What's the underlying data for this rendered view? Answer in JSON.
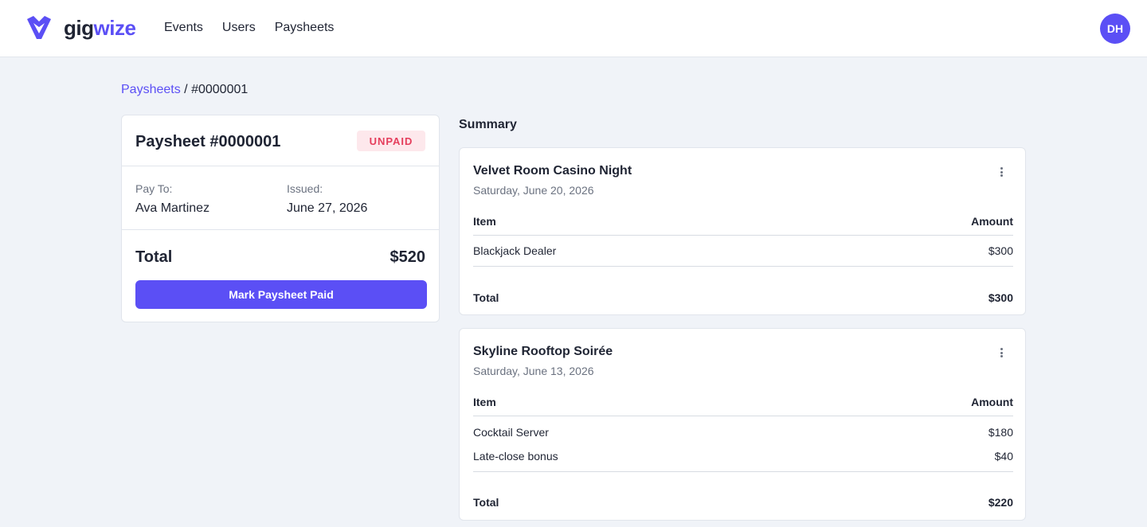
{
  "app": {
    "brand_gig": "gig",
    "brand_wize": "wize",
    "nav": [
      "Events",
      "Users",
      "Paysheets"
    ],
    "avatar_initials": "DH",
    "accent_color": "#5b4ff5"
  },
  "breadcrumb": {
    "parent": "Paysheets",
    "separator": "/",
    "current": "#0000001"
  },
  "paysheet": {
    "title": "Paysheet #0000001",
    "status": "UNPAID",
    "status_color": "#e53e5c",
    "pay_to_label": "Pay To:",
    "pay_to": "Ava Martinez",
    "issued_label": "Issued:",
    "issued": "June 27, 2026",
    "total_label": "Total",
    "total": "$520",
    "action_label": "Mark Paysheet Paid"
  },
  "summary": {
    "title": "Summary",
    "events": [
      {
        "name": "Velvet Room Casino Night",
        "date": "Saturday, June 20, 2026",
        "col_item": "Item",
        "col_amount": "Amount",
        "items": [
          {
            "item": "Blackjack Dealer",
            "amount": "$300"
          }
        ],
        "total_label": "Total",
        "total": "$300"
      },
      {
        "name": "Skyline Rooftop Soirée",
        "date": "Saturday, June 13, 2026",
        "col_item": "Item",
        "col_amount": "Amount",
        "items": [
          {
            "item": "Cocktail Server",
            "amount": "$180"
          },
          {
            "item": "Late-close bonus",
            "amount": "$40"
          }
        ],
        "total_label": "Total",
        "total": "$220"
      }
    ]
  }
}
